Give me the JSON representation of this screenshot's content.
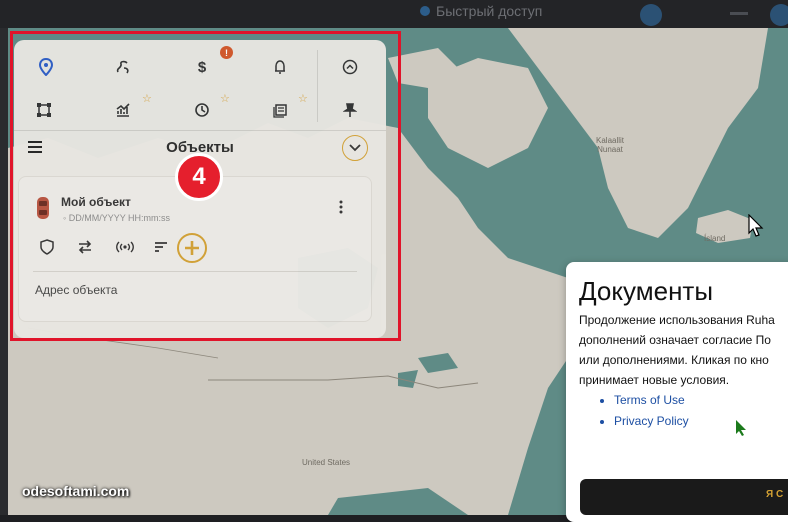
{
  "topbar": {
    "quick_access": "Быстрый доступ"
  },
  "map": {
    "labels": {
      "greenland": "Kalaallit\nNunaat",
      "iceland": "Ísland",
      "usa": "United States"
    }
  },
  "panel": {
    "title": "Объекты",
    "toolbar_row1": [
      "location-pin-icon",
      "route-icon",
      "dollar-icon",
      "bell-icon",
      "chevron-up-circle-icon"
    ],
    "toolbar_row2": [
      "geofence-square-icon",
      "chart-icon",
      "clock-icon",
      "report-icon",
      "pin-icon"
    ],
    "notification_badge": "!",
    "object": {
      "name": "Мой объект",
      "timestamp": "DD/MM/YYYY HH:mm:ss",
      "address": "Адрес объекта"
    }
  },
  "annotation": {
    "step_number": "4"
  },
  "docs_dialog": {
    "title": "Документы",
    "body_lines": [
      "Продолжение использования Ruha",
      "дополнений означает согласие По",
      "или дополнениями. Кликая по кно",
      "принимает новые условия."
    ],
    "links": [
      "Terms of Use",
      "Privacy Policy"
    ],
    "cta_label": "Я С"
  },
  "watermark": "odesoftami.com",
  "colors": {
    "accent": "#d2a033",
    "highlight_red": "#e0142a",
    "map_water": "#5f8b86",
    "map_land": "#cdc9c0"
  }
}
